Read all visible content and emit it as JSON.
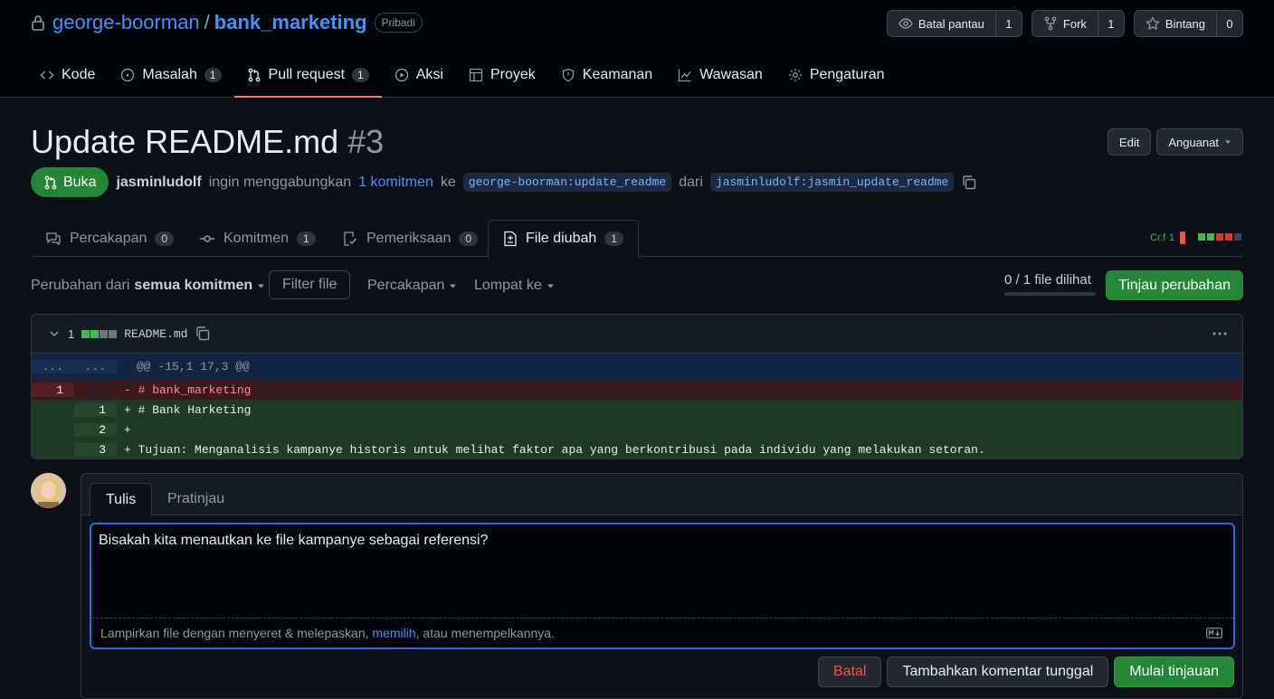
{
  "repo": {
    "owner": "george-boorman",
    "separator": "/",
    "name": "bank_marketing",
    "visibility": "Pribadi"
  },
  "repo_actions": [
    {
      "label": "Batal pantau",
      "count": "1",
      "icon": "eye-icon"
    },
    {
      "label": "Fork",
      "count": "1",
      "icon": "fork-icon"
    },
    {
      "label": "Bintang",
      "count": "0",
      "icon": "star-icon"
    }
  ],
  "nav": {
    "code": "Kode",
    "issues": {
      "label": "Masalah",
      "count": "1"
    },
    "pulls": {
      "label": "Pull request",
      "count": "1"
    },
    "actions": "Aksi",
    "projects": "Proyek",
    "security": "Keamanan",
    "insights": "Wawasan",
    "settings": "Pengaturan"
  },
  "pr": {
    "title": "Update README.md",
    "number": "#3",
    "edit": "Edit",
    "code_btn": "Anguanat",
    "state": "Buka",
    "author": "jasminludolf",
    "text_wants": "ingin menggabungkan",
    "commits_link": "1 komitmen",
    "text_into": "ke",
    "base_branch": "george-boorman:update_readme",
    "text_from": "dari",
    "head_branch": "jasminludolf:jasmin_update_readme"
  },
  "pr_tabs": {
    "conversation": {
      "label": "Percakapan",
      "count": "0"
    },
    "commits": {
      "label": "Komitmen",
      "count": "1"
    },
    "checks": {
      "label": "Pemeriksaan",
      "count": "0"
    },
    "files": {
      "label": "File diubah",
      "count": "1"
    },
    "stats": "Cr.f·1"
  },
  "toolbar": {
    "changes_from": "Perubahan dari",
    "all_commits": "semua komitmen",
    "filter": "Filter file",
    "conversations": "Percakapan",
    "jump": "Lompat ke",
    "viewed": "0 / 1 file dilihat",
    "review": "Tinjau perubahan"
  },
  "file": {
    "count": "1",
    "name": "README.md",
    "hunk_old": "...",
    "hunk_new": "...",
    "hunk": "@@ -15,1 17,3 @@",
    "lines": [
      {
        "type": "del",
        "old": "1",
        "new": "",
        "text": "- # bank_marketing"
      },
      {
        "type": "add",
        "old": "",
        "new": "1",
        "text": "+ # Bank Harketing"
      },
      {
        "type": "add",
        "old": "",
        "new": "2",
        "text": "+"
      },
      {
        "type": "add",
        "old": "",
        "new": "3",
        "text": "+ Tujuan: Menganalisis kampanye historis untuk melihat faktor apa yang berkontribusi pada individu yang melakukan setoran."
      }
    ]
  },
  "comment": {
    "tab_write": "Tulis",
    "tab_preview": "Pratinjau",
    "value": "Bisakah kita menautkan ke file kampanye sebagai referensi?",
    "attach_prefix": "Lampirkan file dengan menyeret & melepaskan,",
    "attach_link": "memilih",
    "attach_suffix": ", atau menempelkannya.",
    "cancel": "Batal",
    "single": "Tambahkan komentar tunggal",
    "start_review": "Mulai tinjauan"
  },
  "colors": {
    "accent": "#4493f8",
    "success": "#238636",
    "danger": "#f85149",
    "tab_underline": "#f78166"
  }
}
